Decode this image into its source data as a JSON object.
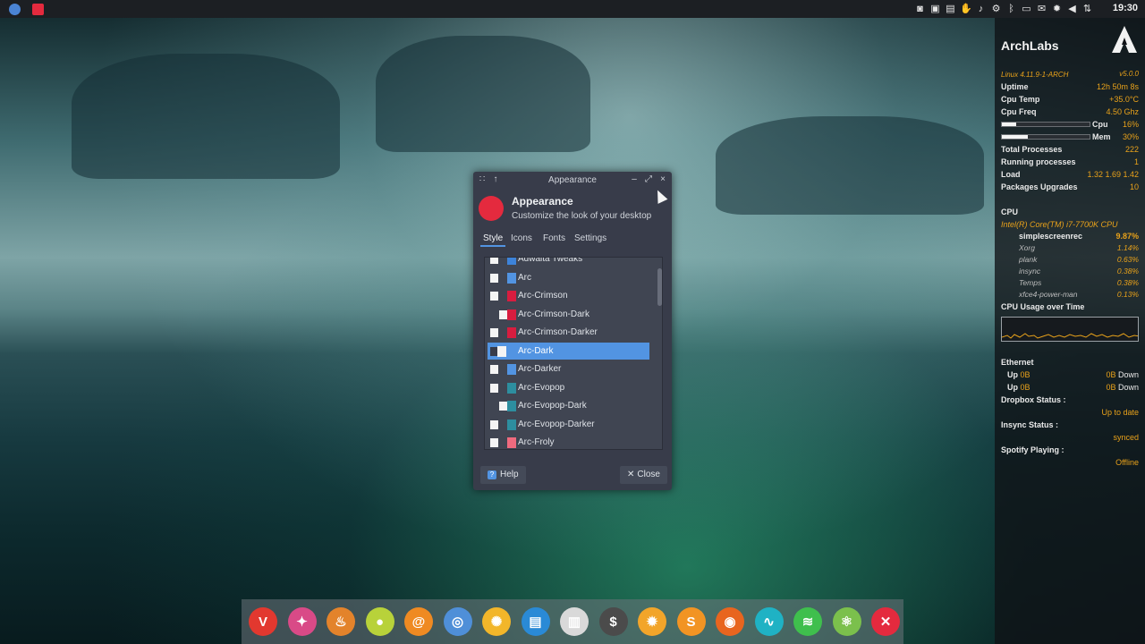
{
  "top_panel": {
    "apps": [
      {
        "icon": "chromium-icon",
        "color": "#4a84d4"
      },
      {
        "icon": "archlabs-icon",
        "color": "#e42a3e"
      }
    ],
    "tray_icons": [
      "camera-icon",
      "clipboard-icon",
      "notes-icon",
      "hand-icon",
      "sound-icon",
      "settings-icon",
      "bluetooth-icon",
      "screen-icon",
      "mail-icon",
      "gear-icon",
      "volume-icon",
      "network-icon"
    ],
    "clock": "19:30"
  },
  "conky": {
    "brand": "ArchLabs",
    "kernel": "Linux 4.11.9-1-ARCH",
    "version": "v5.0.0",
    "stats": [
      {
        "label": "Uptime",
        "value": "12h 50m 8s"
      },
      {
        "label": "Cpu Temp",
        "value": "+35.0°C"
      },
      {
        "label": "Cpu Freq",
        "value": "4.50 Ghz"
      }
    ],
    "bars": [
      {
        "label": "Cpu",
        "value": "16%",
        "fraction": 0.16
      },
      {
        "label": "Mem",
        "value": "30%",
        "fraction": 0.3
      }
    ],
    "stats2": [
      {
        "label": "Total Processes",
        "value": "222"
      },
      {
        "label": "Running processes",
        "value": "1"
      },
      {
        "label": "Load",
        "value": "1.32 1.69 1.42"
      },
      {
        "label": "Packages Upgrades",
        "value": "10"
      }
    ],
    "cpu_heading": "CPU",
    "cpu_model": "Intel(R) Core(TM) i7-7700K CPU",
    "processes": [
      {
        "name": "simplescreenrec",
        "pct": "9.87%"
      },
      {
        "name": "Xorg",
        "pct": "1.14%"
      },
      {
        "name": "plank",
        "pct": "0.63%"
      },
      {
        "name": "insync",
        "pct": "0.38%"
      },
      {
        "name": "Temps",
        "pct": "0.38%"
      },
      {
        "name": "xfce4-power-man",
        "pct": "0.13%"
      }
    ],
    "graph_title": "CPU Usage over Time",
    "ethernet_label": "Ethernet",
    "net": [
      {
        "up_label": "Up",
        "up": "0B",
        "down": "0B",
        "down_label": "Down"
      },
      {
        "up_label": "Up",
        "up": "0B",
        "down": "0B",
        "down_label": "Down"
      }
    ],
    "statuses": [
      {
        "label": "Dropbox Status :",
        "value": "Up to date"
      },
      {
        "label": "Insync Status :",
        "value": "synced"
      },
      {
        "label": "Spotify Playing :",
        "value": "Offline"
      }
    ]
  },
  "dialog": {
    "window_title": "Appearance",
    "title": "Appearance",
    "subtitle": "Customize the look of your desktop",
    "tabs": [
      "Style",
      "Icons",
      "Fonts",
      "Settings"
    ],
    "active_tab": "Style",
    "themes": [
      {
        "name": "Adwaita Tweaks",
        "c1": "#f4f4f4",
        "c2": "#3d83d9",
        "indent": false
      },
      {
        "name": "Arc",
        "c1": "#f4f4f4",
        "c2": "#5294e2",
        "indent": false
      },
      {
        "name": "Arc-Crimson",
        "c1": "#f4f4f4",
        "c2": "#d81d3f",
        "indent": false
      },
      {
        "name": "Arc-Crimson-Dark",
        "c1": "#f4f4f4",
        "c2": "#d81d3f",
        "indent": true
      },
      {
        "name": "Arc-Crimson-Darker",
        "c1": "#f4f4f4",
        "c2": "#d81d3f",
        "indent": false
      },
      {
        "name": "Arc-Dark",
        "c1": "#383c4a",
        "c2": "#f4f4f4",
        "indent": false,
        "selected": true
      },
      {
        "name": "Arc-Darker",
        "c1": "#f4f4f4",
        "c2": "#5294e2",
        "indent": false
      },
      {
        "name": "Arc-Evopop",
        "c1": "#f4f4f4",
        "c2": "#2d8e9f",
        "indent": false
      },
      {
        "name": "Arc-Evopop-Dark",
        "c1": "#f4f4f4",
        "c2": "#2d8e9f",
        "indent": true
      },
      {
        "name": "Arc-Evopop-Darker",
        "c1": "#f4f4f4",
        "c2": "#2d8e9f",
        "indent": false
      },
      {
        "name": "Arc-Froly",
        "c1": "#f4f4f4",
        "c2": "#ef6a7e",
        "indent": false
      }
    ],
    "help_label": "Help",
    "close_label": "Close"
  },
  "dock": {
    "apps": [
      {
        "icon": "vivaldi-icon",
        "color": "#e2382f",
        "glyph": "V"
      },
      {
        "icon": "hexchat-icon",
        "color": "#d94a87",
        "glyph": "✦"
      },
      {
        "icon": "teapot-icon",
        "color": "#e3832b",
        "glyph": "♨"
      },
      {
        "icon": "lemon-icon",
        "color": "#b8d23a",
        "glyph": "●"
      },
      {
        "icon": "swirl-icon",
        "color": "#ef8a22",
        "glyph": "@"
      },
      {
        "icon": "chromium-icon",
        "color": "#4f8fd8",
        "glyph": "◎"
      },
      {
        "icon": "aperture-icon",
        "color": "#f2b62a",
        "glyph": "✺"
      },
      {
        "icon": "file-manager-icon",
        "color": "#2a8ad6",
        "glyph": "▤"
      },
      {
        "icon": "libreoffice-icon",
        "color": "#d9d9d9",
        "glyph": "▥"
      },
      {
        "icon": "terminal-icon",
        "color": "#4b4b4b",
        "glyph": "$"
      },
      {
        "icon": "settings-app-icon",
        "color": "#f2a52a",
        "glyph": "✹"
      },
      {
        "icon": "sublime-icon",
        "color": "#f29423",
        "glyph": "S"
      },
      {
        "icon": "firefox-icon",
        "color": "#e8651f",
        "glyph": "◉"
      },
      {
        "icon": "audio-icon",
        "color": "#1fb2c4",
        "glyph": "∿"
      },
      {
        "icon": "spotify-icon",
        "color": "#3fbf4d",
        "glyph": "≋"
      },
      {
        "icon": "atom-icon",
        "color": "#7bc04c",
        "glyph": "⚛"
      },
      {
        "icon": "archlabs-dock-icon",
        "color": "#e42a3e",
        "glyph": "✕"
      }
    ]
  }
}
